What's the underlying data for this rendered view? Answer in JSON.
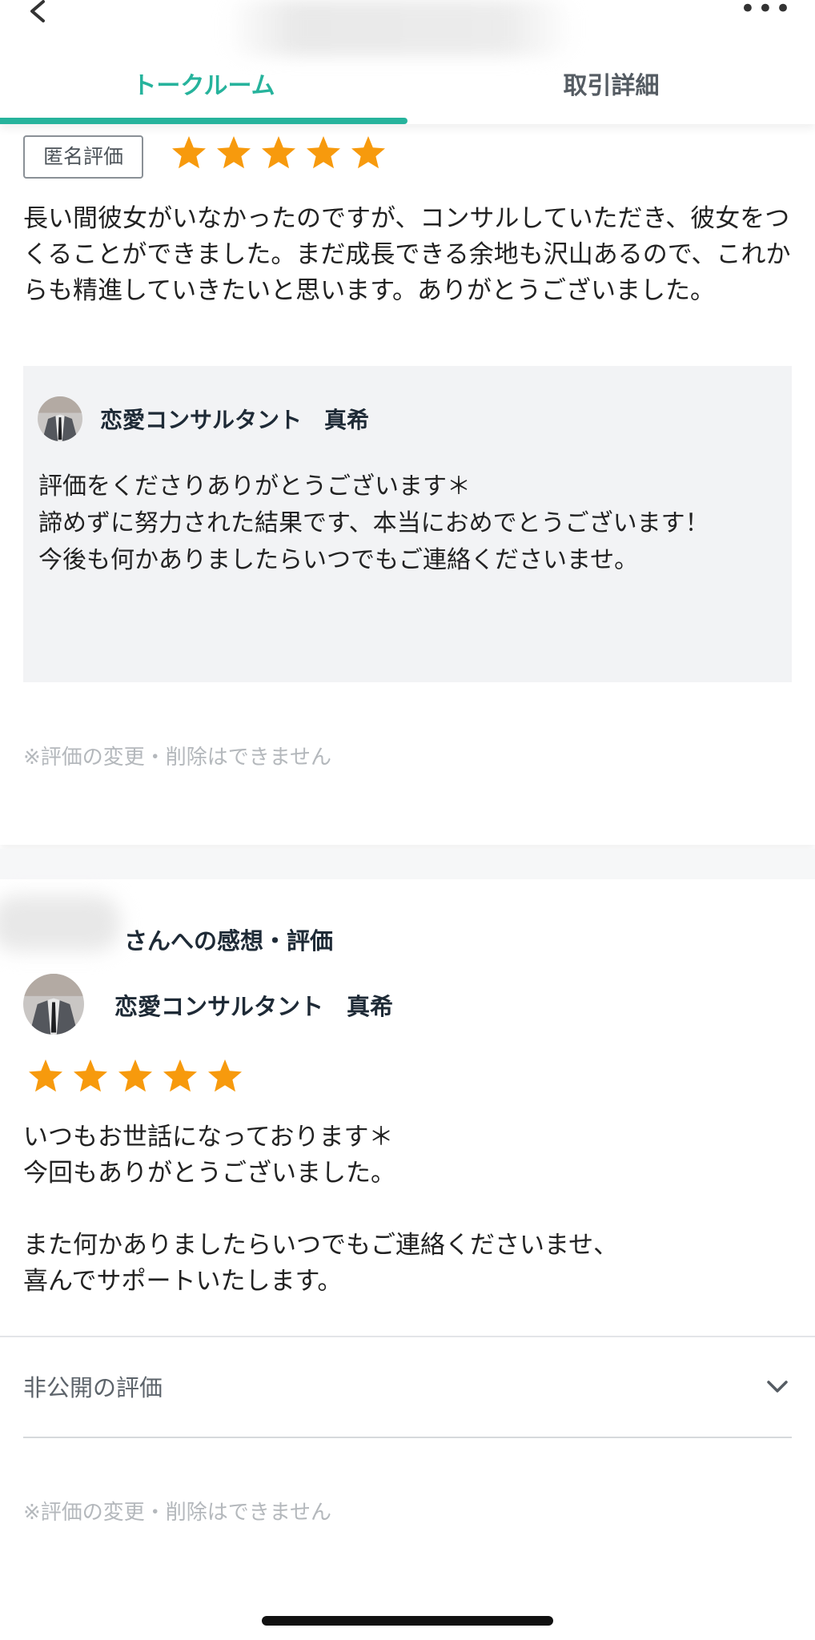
{
  "header": {
    "tabs": [
      {
        "label": "トークルーム",
        "active": true
      },
      {
        "label": "取引詳細",
        "active": false
      }
    ],
    "accent_color": "#26b39c"
  },
  "review": {
    "badge": "匿名評価",
    "rating": 5,
    "text": "長い間彼女がいなかったのですが、コンサルしていただき、彼女をつくることができました。まだ成長できる余地も沢山あるので、これからも精進していきたいと思います。ありがとうございました。",
    "reply": {
      "name": "恋愛コンサルタント　真希",
      "text": "評価をくださりありがとうございます＊\n諦めずに努力された結果です、本当におめでとうございます！\n今後も何かありましたらいつでもご連絡くださいませ。"
    },
    "note": "※評価の変更・削除はできません"
  },
  "seller_review": {
    "heading": "さんへの感想・評価",
    "name": "恋愛コンサルタント　真希",
    "rating": 5,
    "text": "いつもお世話になっております＊\n今回もありがとうございました。\n\nまた何かありましたらいつでもご連絡くださいませ、\n喜んでサポートいたします。",
    "private_label": "非公開の評価",
    "note": "※評価の変更・削除はできません"
  },
  "star_color": "#f79a0d"
}
